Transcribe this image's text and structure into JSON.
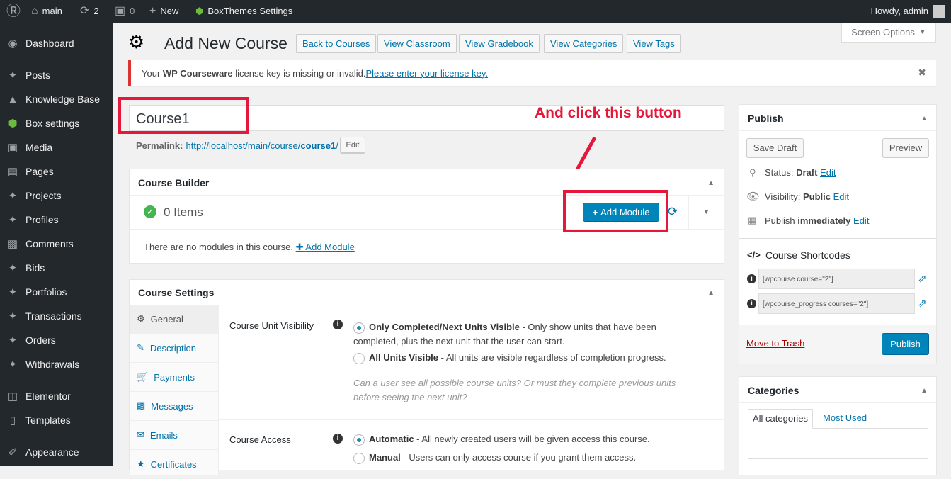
{
  "adminbar": {
    "site": "main",
    "updates": "2",
    "comments": "0",
    "new": "New",
    "plugin": "BoxThemes Settings",
    "howdy": "Howdy, admin"
  },
  "sidebar": {
    "items": [
      {
        "label": "Dashboard",
        "icon": "dashboard-icon"
      },
      {
        "label": "Posts",
        "icon": "pin-icon"
      },
      {
        "label": "Knowledge Base",
        "icon": "graduation-cap-icon"
      },
      {
        "label": "Box settings",
        "icon": "cube-icon"
      },
      {
        "label": "Media",
        "icon": "media-icon"
      },
      {
        "label": "Pages",
        "icon": "pages-icon"
      },
      {
        "label": "Projects",
        "icon": "pin-icon"
      },
      {
        "label": "Profiles",
        "icon": "pin-icon"
      },
      {
        "label": "Comments",
        "icon": "comment-icon"
      },
      {
        "label": "Bids",
        "icon": "pin-icon"
      },
      {
        "label": "Portfolios",
        "icon": "pin-icon"
      },
      {
        "label": "Transactions",
        "icon": "pin-icon"
      },
      {
        "label": "Orders",
        "icon": "pin-icon"
      },
      {
        "label": "Withdrawals",
        "icon": "pin-icon"
      },
      {
        "label": "Elementor",
        "icon": "elementor-icon"
      },
      {
        "label": "Templates",
        "icon": "folder-icon"
      },
      {
        "label": "Appearance",
        "icon": "brush-icon"
      }
    ]
  },
  "header": {
    "title": "Add New Course",
    "buttons": [
      "Back to Courses",
      "View Classroom",
      "View Gradebook",
      "View Categories",
      "View Tags"
    ],
    "screen_options": "Screen Options"
  },
  "notice": {
    "prefix": "Your ",
    "bold": "WP Courseware",
    "text": " license key is missing or invalid. ",
    "link": "Please enter your license key."
  },
  "title_input": {
    "value": "Course1"
  },
  "annotation": "And click this button",
  "permalink": {
    "label": "Permalink:",
    "url_prefix": "http://localhost/main/course/",
    "url_slug": "course1",
    "url_suffix": "/",
    "edit": "Edit"
  },
  "builder": {
    "title": "Course Builder",
    "items": "0 Items",
    "add_module": "Add Module",
    "empty_text": "There are no modules in this course.",
    "empty_link": "Add Module"
  },
  "settings": {
    "title": "Course Settings",
    "tabs": [
      "General",
      "Description",
      "Payments",
      "Messages",
      "Emails",
      "Certificates"
    ],
    "visibility": {
      "label": "Course Unit Visibility",
      "opt1_bold": "Only Completed/Next Units Visible",
      "opt1_text": " - Only show units that have been completed, plus the next unit that the user can start.",
      "opt2_bold": "All Units Visible",
      "opt2_text": " - All units are visible regardless of completion progress.",
      "help": "Can a user see all possible course units? Or must they complete previous units before seeing the next unit?"
    },
    "access": {
      "label": "Course Access",
      "opt1_bold": "Automatic",
      "opt1_text": " - All newly created users will be given access this course.",
      "opt2_bold": "Manual",
      "opt2_text": " - Users can only access course if you grant them access."
    }
  },
  "publish": {
    "title": "Publish",
    "save_draft": "Save Draft",
    "preview": "Preview",
    "status_label": "Status: ",
    "status": "Draft",
    "visibility_label": "Visibility: ",
    "visibility": "Public",
    "publish_label": "Publish ",
    "publish_when": "immediately",
    "edit": "Edit",
    "shortcodes_title": "Course Shortcodes",
    "shortcodes": [
      "[wpcourse course=\"2\"]",
      "[wpcourse_progress courses=\"2\"]"
    ],
    "trash": "Move to Trash",
    "publish_btn": "Publish"
  },
  "categories": {
    "title": "Categories",
    "tabs": [
      "All categories",
      "Most Used"
    ]
  },
  "colors": {
    "accent": "#0085ba",
    "annotation": "#e5173a",
    "adminbar": "#23282d"
  }
}
